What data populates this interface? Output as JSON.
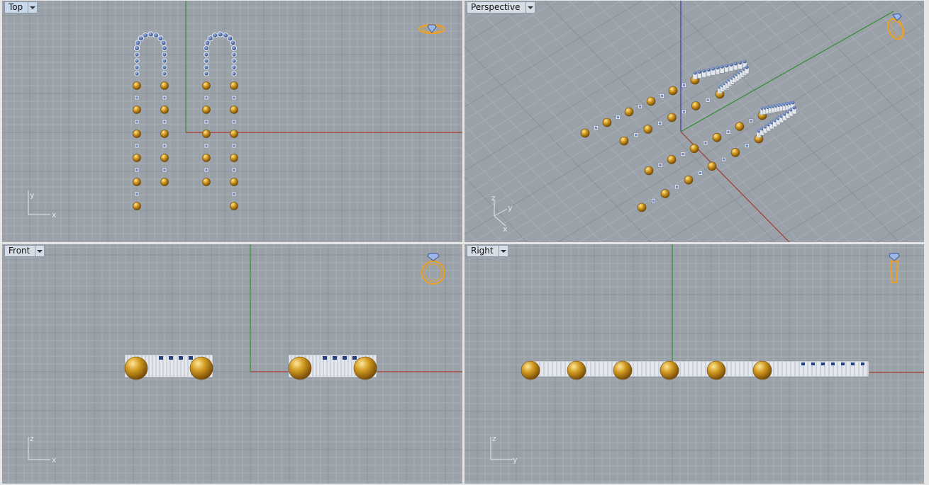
{
  "viewports": [
    {
      "id": "top",
      "title": "Top",
      "axis_labels": [
        "y",
        "x"
      ],
      "active": true
    },
    {
      "id": "perspective",
      "title": "Perspective",
      "axis_labels": [
        "z",
        "y",
        "x"
      ],
      "active": false
    },
    {
      "id": "front",
      "title": "Front",
      "axis_labels": [
        "z",
        "x"
      ],
      "active": false
    },
    {
      "id": "right",
      "title": "Right",
      "axis_labels": [
        "z",
        "y"
      ],
      "active": false
    }
  ],
  "colors": {
    "viewport_bg": "#9aa1a8",
    "grid_minor": "#a8aeb5",
    "grid_major": "#8b9198",
    "x_axis": "#a83a2e",
    "y_axis": "#2f8f2f",
    "z_axis": "#3a3aa8",
    "gold_bead": "#c9941e",
    "blue_gem": "#3a5a9a",
    "silver": "#e4e8ee",
    "gizmo": "#f0a020"
  },
  "icons": {
    "viewport_menu": "chevron-down-icon",
    "view_gizmo": "ring-gizmo-icon",
    "axis_indicator": "axis-triad-icon"
  }
}
